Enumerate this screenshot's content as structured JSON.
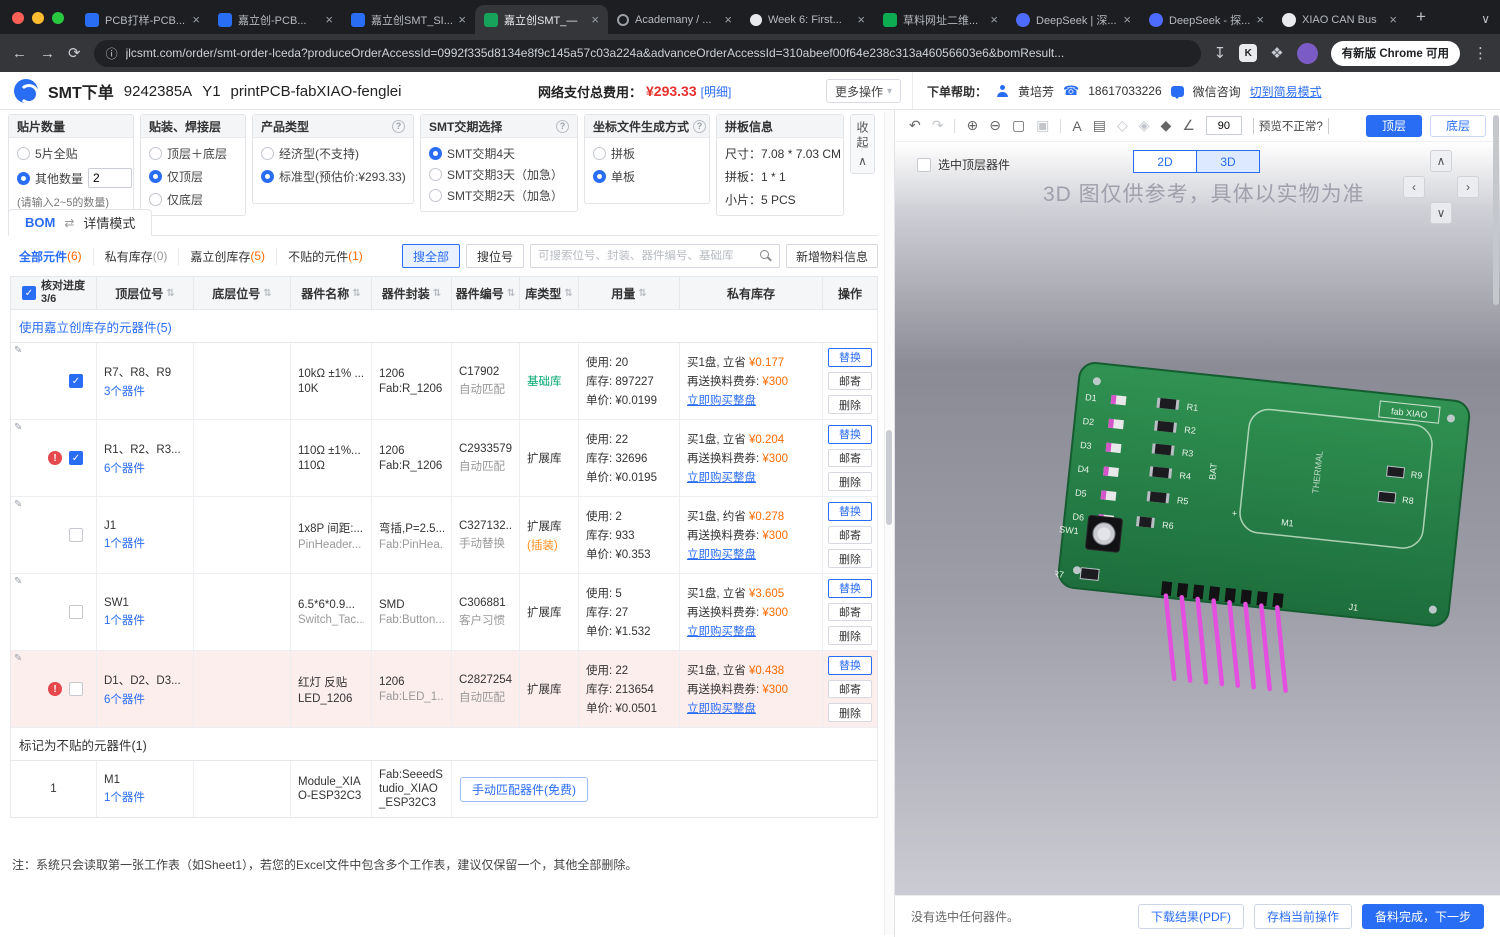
{
  "icons": {
    "close": "×",
    "plus": "+",
    "chevron_down": "∨",
    "back": "←",
    "forward": "→",
    "refresh": "⟳",
    "download": "↧",
    "kami": "K",
    "extensions": "❖",
    "kebab": "⋮",
    "site_info": "ⓘ",
    "sort": "⇅",
    "edit": "✎",
    "warning": "!",
    "check": "✓",
    "undo": "↶",
    "redo": "↷",
    "zoom_in": "⊕",
    "zoom_out": "⊖",
    "fit": "▢",
    "crop": "▣",
    "text_tool": "A",
    "grid_tool": "▤",
    "layer_outline": "◇",
    "layer_mixed": "◈",
    "layer_filled": "◆",
    "angle_tool": "∠",
    "swap": "⇄",
    "caret_down": "▾",
    "phone": "☎",
    "help": "?",
    "arrow_up": "∧",
    "arrow_down": "∨",
    "arrow_left": "‹",
    "arrow_right": "›"
  },
  "browser": {
    "tabs": [
      {
        "label": "PCB打样-PCB..."
      },
      {
        "label": "嘉立创-PCB..."
      },
      {
        "label": "嘉立创SMT_SI..."
      },
      {
        "label": "嘉立创SMT_—"
      },
      {
        "label": "Academany / ..."
      },
      {
        "label": "Week 6: First..."
      },
      {
        "label": "草料网址二维..."
      },
      {
        "label": "DeepSeek | 深..."
      },
      {
        "label": "DeepSeek - 探..."
      },
      {
        "label": "XIAO CAN Bus"
      }
    ],
    "url": "jlcsmt.com/order/smt-order-lceda?produceOrderAccessId=0992f335d8134e8f9c145a57c03a224a&advanceOrderAccessId=310abeef00f64e238c313a46056603e6&bomResult...",
    "update_button": "有新版 Chrome 可用"
  },
  "header": {
    "title": "SMT下单",
    "order_no": "9242385A",
    "variant": "Y1",
    "board": "printPCB-fabXIAO-fenglei",
    "fee_label": "网络支付总费用：",
    "fee": "¥293.33",
    "fee_detail": "[明细]",
    "more_actions": "更多操作",
    "help_label": "下单帮助：",
    "helper": "黄培芳",
    "phone": "18617033226",
    "wechat": "微信咨询",
    "simple_mode": "切到简易模式"
  },
  "options": {
    "qty": {
      "title": "贴片数量",
      "opt1": "5片全贴",
      "opt2": "其他数量",
      "value": "2",
      "note": "(请输入2~5的数量)"
    },
    "layer": {
      "title": "贴装、焊接层",
      "opt1": "顶层＋底层",
      "opt2": "仅顶层",
      "opt3": "仅底层"
    },
    "product": {
      "title": "产品类型",
      "opt1": "经济型(不支持)",
      "opt2": "标准型(预估价:¥293.33)"
    },
    "lead": {
      "title": "SMT交期选择",
      "opt1": "SMT交期4天",
      "opt2": "SMT交期3天（加急）",
      "opt3": "SMT交期2天（加急）"
    },
    "coord": {
      "title": "坐标文件生成方式",
      "opt1": "拼板",
      "opt2": "单板"
    },
    "panel_info": {
      "title": "拼板信息",
      "line1": "尺寸：7.08 * 7.03 CM",
      "line2": "拼板：1 * 1",
      "line3": "小片：5 PCS"
    },
    "collapse": "收起"
  },
  "bom": {
    "tab": "BOM",
    "mode": "详情模式",
    "filters": [
      {
        "label": "全部元件",
        "count": "(6)"
      },
      {
        "label": "私有库存",
        "count": "(0)"
      },
      {
        "label": "嘉立创库存",
        "count": "(5)"
      },
      {
        "label": "不贴的元件",
        "count": "(1)"
      }
    ],
    "search_all": "搜全部",
    "search_ref": "搜位号",
    "search_placeholder": "可搜索位号、封装、器件编号、基础库",
    "add_material": "新增物料信息",
    "check_label": "核对进度",
    "check_value": "3/6",
    "col_top": "顶层位号",
    "col_bottom": "底层位号",
    "col_name": "器件名称",
    "col_pkg": "器件封装",
    "col_pn": "器件编号",
    "col_lib": "库类型",
    "col_qty": "用量",
    "col_private": "私有库存",
    "col_action": "操作",
    "group1": "使用嘉立创库存的元器件(5)",
    "group2": "标记为不贴的元器件(1)",
    "actions": {
      "replace": "替换",
      "mail": "邮寄",
      "delete": "删除"
    },
    "rows": [
      {
        "refs": "R7、R8、R9",
        "count": "3个器件",
        "name1": "10kΩ ±1% ...",
        "name2": "10K",
        "pkg1": "1206",
        "pkg2": "Fab:R_1206",
        "pn": "C17902",
        "match": "自动匹配",
        "lib": "基础库",
        "use": "使用: 20",
        "stock": "库存: 897227",
        "price": "单价: ¥0.0199",
        "save_prefix": "买1盘, 立省",
        "save_amt": "¥0.177",
        "coupon_prefix": "再送换料费券:",
        "coupon_amt": "¥300",
        "buy": "立即购买整盘"
      },
      {
        "refs": "R1、R2、R3...",
        "count": "6个器件",
        "name1": "110Ω ±1%...",
        "name2": "110Ω",
        "pkg1": "1206",
        "pkg2": "Fab:R_1206",
        "pn": "C2933579",
        "match": "自动匹配",
        "lib": "扩展库",
        "use": "使用: 22",
        "stock": "库存: 32696",
        "price": "单价: ¥0.0195",
        "save_prefix": "买1盘, 立省",
        "save_amt": "¥0.204",
        "coupon_prefix": "再送换料费券:",
        "coupon_amt": "¥300",
        "buy": "立即购买整盘"
      },
      {
        "refs": "J1",
        "count": "1个器件",
        "name1": "1x8P 间距:...",
        "name2": "PinHeader...",
        "pkg1": "弯插,P=2.5...",
        "pkg2": "Fab:PinHea...",
        "pn": "C327132...",
        "match": "手动替换",
        "lib": "扩展库",
        "lib_note": "(插装)",
        "use": "使用: 2",
        "stock": "库存: 933",
        "price": "单价: ¥0.353",
        "save_prefix": "买1盘, 约省",
        "save_amt": "¥0.278",
        "coupon_prefix": "再送换料费券:",
        "coupon_amt": "¥300",
        "buy": "立即购买整盘"
      },
      {
        "refs": "SW1",
        "count": "1个器件",
        "name1": "6.5*6*0.9...",
        "name2": "Switch_Tac...",
        "pkg1": "SMD",
        "pkg2": "Fab:Button...",
        "pn": "C306881",
        "match": "客户习惯",
        "lib": "扩展库",
        "use": "使用: 5",
        "stock": "库存: 27",
        "price": "单价: ¥1.532",
        "save_prefix": "买1盘, 立省",
        "save_amt": "¥3.605",
        "coupon_prefix": "再送换料费券:",
        "coupon_amt": "¥300",
        "buy": "立即购买整盘"
      },
      {
        "refs": "D1、D2、D3...",
        "count": "6个器件",
        "name1": "红灯 反贴",
        "name2": "LED_1206",
        "pkg1": "1206",
        "pkg2": "Fab:LED_1...",
        "pn": "C2827254",
        "match": "自动匹配",
        "lib": "扩展库",
        "use": "使用: 22",
        "stock": "库存: 213654",
        "price": "单价: ¥0.0501",
        "save_prefix": "买1盘, 立省",
        "save_amt": "¥0.438",
        "coupon_prefix": "再送换料费券:",
        "coupon_amt": "¥300",
        "buy": "立即购买整盘"
      }
    ],
    "nomount": {
      "index": "1",
      "refs": "M1",
      "count": "1个器件",
      "name": "Module_XIAO-ESP32C3",
      "pkg": "Fab:SeeedStudio_XIAO_ESP32C3",
      "match_btn": "手动匹配器件(免费)"
    },
    "note": "注：系统只会读取第一张工作表（如Sheet1），若您的Excel文件中包含多个工作表，建议仅保留一个，其他全部删除。"
  },
  "viewer": {
    "angle": "90",
    "preview_issue": "预览不正常?",
    "top": "顶层",
    "bottom": "底层",
    "select_top": "选中顶层器件",
    "mode_2d": "2D",
    "mode_3d": "3D",
    "watermark": "3D 图仅供参考，具体以实物为准",
    "status": "没有选中任何器件。",
    "btn_pdf": "下载结果(PDF)",
    "btn_archive": "存档当前操作",
    "btn_next": "备料完成，下一步",
    "labels": {
      "d1": "D1",
      "d2": "D2",
      "d3": "D3",
      "d4": "D4",
      "d5": "D5",
      "d6": "D6",
      "r1": "R1",
      "r2": "R2",
      "r3": "R3",
      "r4": "R4",
      "r5": "R5",
      "r6": "R6",
      "r7": "R7",
      "r8": "R8",
      "r9": "R9",
      "sw1": "SW1",
      "m1": "M1",
      "j1": "J1",
      "bat": "BAT",
      "plus": "+",
      "thermal": "THERMAL",
      "fab": "fab XIAO"
    }
  }
}
